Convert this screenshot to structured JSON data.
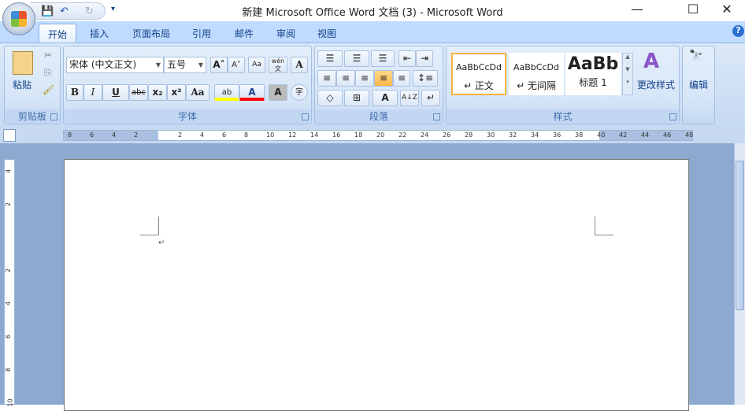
{
  "window": {
    "title": "新建 Microsoft Office Word 文档 (3) - Microsoft Word",
    "minimize": "—",
    "maximize": "☐",
    "close": "✕"
  },
  "qat": {
    "save": "💾",
    "undo": "↶",
    "redo": "↻",
    "customize": "▾"
  },
  "tabs": [
    {
      "label": "开始"
    },
    {
      "label": "插入"
    },
    {
      "label": "页面布局"
    },
    {
      "label": "引用"
    },
    {
      "label": "邮件"
    },
    {
      "label": "审阅"
    },
    {
      "label": "视图"
    }
  ],
  "help": "?",
  "clipboard": {
    "paste": "粘贴",
    "label": "剪贴板",
    "cut": "✂",
    "copy": "⎘",
    "format_painter": "🖌"
  },
  "font": {
    "name": "宋体 (中文正文)",
    "size": "五号",
    "grow": "A˄",
    "shrink": "A˅",
    "clear": "Aa",
    "phonetic": "wén文",
    "border": "A",
    "bold": "B",
    "italic": "I",
    "underline": "U",
    "strike": "abc",
    "sub": "x₂",
    "sup": "x²",
    "case": "Aa",
    "highlight": "ab",
    "font_color": "A",
    "shading": "A",
    "enclose": "字",
    "label": "字体",
    "highlight_color": "#ffff00",
    "font_color_value": "#ff0000"
  },
  "paragraph": {
    "label": "段落",
    "bullets": "☰",
    "numbering": "☰",
    "multilevel": "☰",
    "dec_indent": "⇤",
    "inc_indent": "⇥",
    "align_left": "≡",
    "center": "≡",
    "align_right": "≡",
    "justify": "≡",
    "distribute": "≡",
    "line_spacing": "↕≡",
    "shading": "◇",
    "borders": "⊞",
    "chinese_layout": "A",
    "sort": "A↓Z",
    "show_marks": "↵"
  },
  "styles": {
    "label": "样式",
    "items": [
      {
        "preview": "AaBbCcDd",
        "name": "↵ 正文"
      },
      {
        "preview": "AaBbCcDd",
        "name": "↵ 无间隔"
      },
      {
        "preview": "AaBb",
        "name": "标题 1"
      }
    ],
    "change": "更改样式"
  },
  "editing": {
    "label": "编辑",
    "icon": "🔭"
  },
  "ruler": {
    "numbers": [
      "8",
      "6",
      "4",
      "2",
      "",
      "2",
      "4",
      "6",
      "8",
      "10",
      "12",
      "14",
      "16",
      "18",
      "20",
      "22",
      "24",
      "26",
      "28",
      "30",
      "32",
      "34",
      "36",
      "38",
      "40",
      "42",
      "44",
      "46",
      "48"
    ]
  },
  "vruler": {
    "numbers": [
      "4",
      "2",
      "",
      "2",
      "4",
      "6",
      "8",
      "10"
    ]
  },
  "document": {
    "paragraph_mark": "↵"
  }
}
